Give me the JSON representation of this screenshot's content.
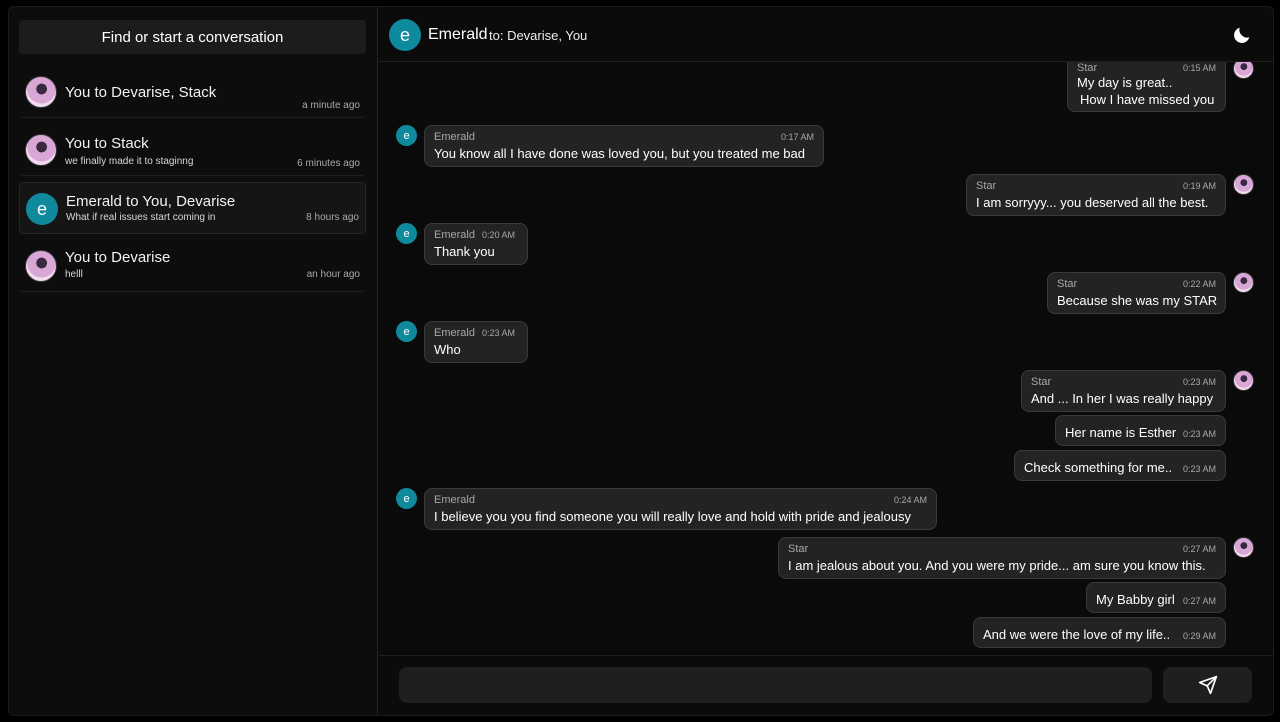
{
  "sidebar": {
    "search_label": "Find or start a conversation",
    "conversations": [
      {
        "title": "You to Devarise, Stack",
        "preview": "",
        "time": "a minute ago",
        "avatar": "photo"
      },
      {
        "title": "You to Stack",
        "preview": "we finally made it to staginng",
        "time": "6 minutes ago",
        "avatar": "photo"
      },
      {
        "title": "Emerald to You, Devarise",
        "preview": "What if real issues start coming in",
        "time": "8 hours ago",
        "avatar": "e"
      },
      {
        "title": "You to Devarise",
        "preview": "helll",
        "time": "an hour ago",
        "avatar": "photo"
      }
    ]
  },
  "header": {
    "avatar_letter": "e",
    "name": "Emerald",
    "to": "to:  Devarise, You",
    "theme_icon": "moon-icon"
  },
  "messages": [
    {
      "sender": "Star",
      "time": "0:15 AM",
      "text": "My day is great..",
      "text2": "How I have missed you",
      "side": "right"
    },
    {
      "sender": "Emerald",
      "time": "0:17 AM",
      "text": "You know all I have done was loved you, but you treated me bad",
      "side": "left"
    },
    {
      "sender": "Star",
      "time": "0:19 AM",
      "text": "I am sorryyy... you deserved all the best.",
      "side": "right"
    },
    {
      "sender": "Emerald",
      "time": "0:20 AM",
      "text": "Thank you",
      "side": "left"
    },
    {
      "sender": "Star",
      "time": "0:22 AM",
      "text": "Because she was my STAR",
      "side": "right"
    },
    {
      "sender": "Emerald",
      "time": "0:23 AM",
      "text": "Who",
      "side": "left"
    },
    {
      "sender": "Star",
      "time": "0:23 AM",
      "text": "And ... In her I was really happy",
      "side": "right"
    },
    {
      "sender": "",
      "time": "0:23 AM",
      "text": "Her name is Esther",
      "side": "right"
    },
    {
      "sender": "",
      "time": "0:23 AM",
      "text": "Check something for me..",
      "side": "right"
    },
    {
      "sender": "Emerald",
      "time": "0:24 AM",
      "text": "I believe you you find someone you will really love and hold with pride and jealousy",
      "side": "left"
    },
    {
      "sender": "Star",
      "time": "0:27 AM",
      "text": "I am jealous about you. And you were my pride... am sure you know this.",
      "side": "right"
    },
    {
      "sender": "",
      "time": "0:27 AM",
      "text": "My Babby girl",
      "side": "right"
    },
    {
      "sender": "",
      "time": "0:29 AM",
      "text": "And we were the love of my life..",
      "side": "right"
    }
  ],
  "composer": {
    "placeholder": "",
    "send_icon": "send-icon"
  },
  "colors": {
    "accent": "#0e8a9c",
    "bubble": "#232323",
    "background": "#0a0a0a"
  }
}
